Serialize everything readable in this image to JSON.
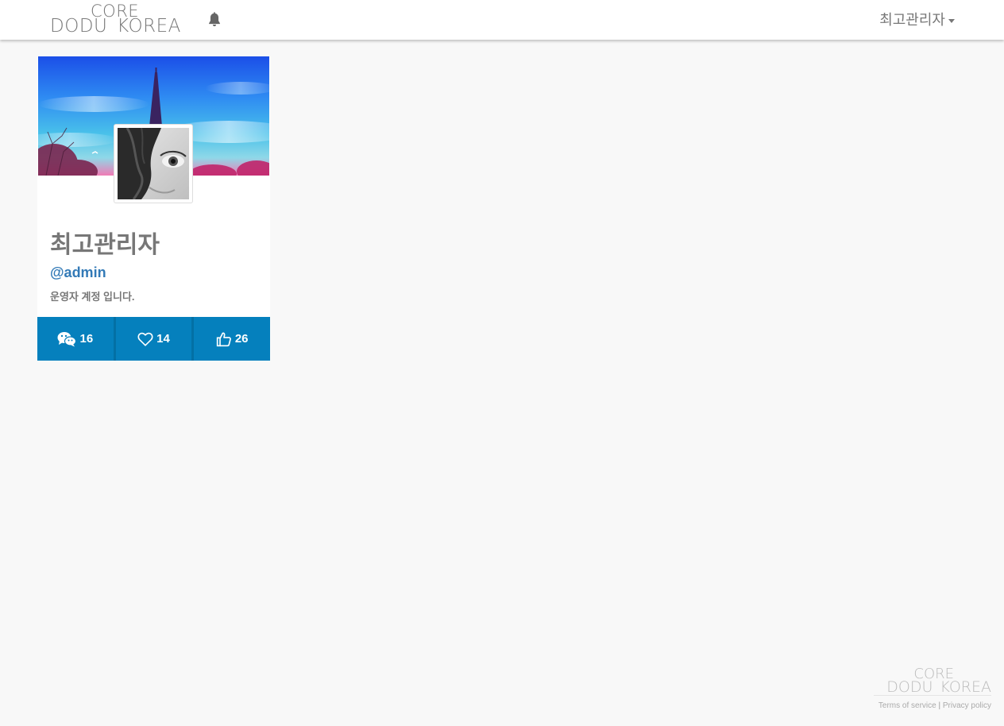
{
  "header": {
    "logo": {
      "top": "CORE",
      "bottom": "DODU  KOREA"
    },
    "notifications_icon": "bell-icon",
    "user_menu_label": "최고관리자"
  },
  "profile": {
    "name": "최고관리자",
    "username": "@admin",
    "bio": "운영자 계정 입니다.",
    "stats": [
      {
        "icon": "chat-icon",
        "value": "16"
      },
      {
        "icon": "heart-icon",
        "value": "14"
      },
      {
        "icon": "thumbs-up-icon",
        "value": "26"
      }
    ]
  },
  "footer": {
    "logo": {
      "top": "CORE",
      "bottom": "DODU  KOREA"
    },
    "terms": "Terms of service",
    "separator": "|",
    "privacy": "Privacy policy"
  },
  "colors": {
    "accent": "#0580bd",
    "link": "#337ab7",
    "text_muted": "#777777",
    "background": "#f8f8f8"
  }
}
